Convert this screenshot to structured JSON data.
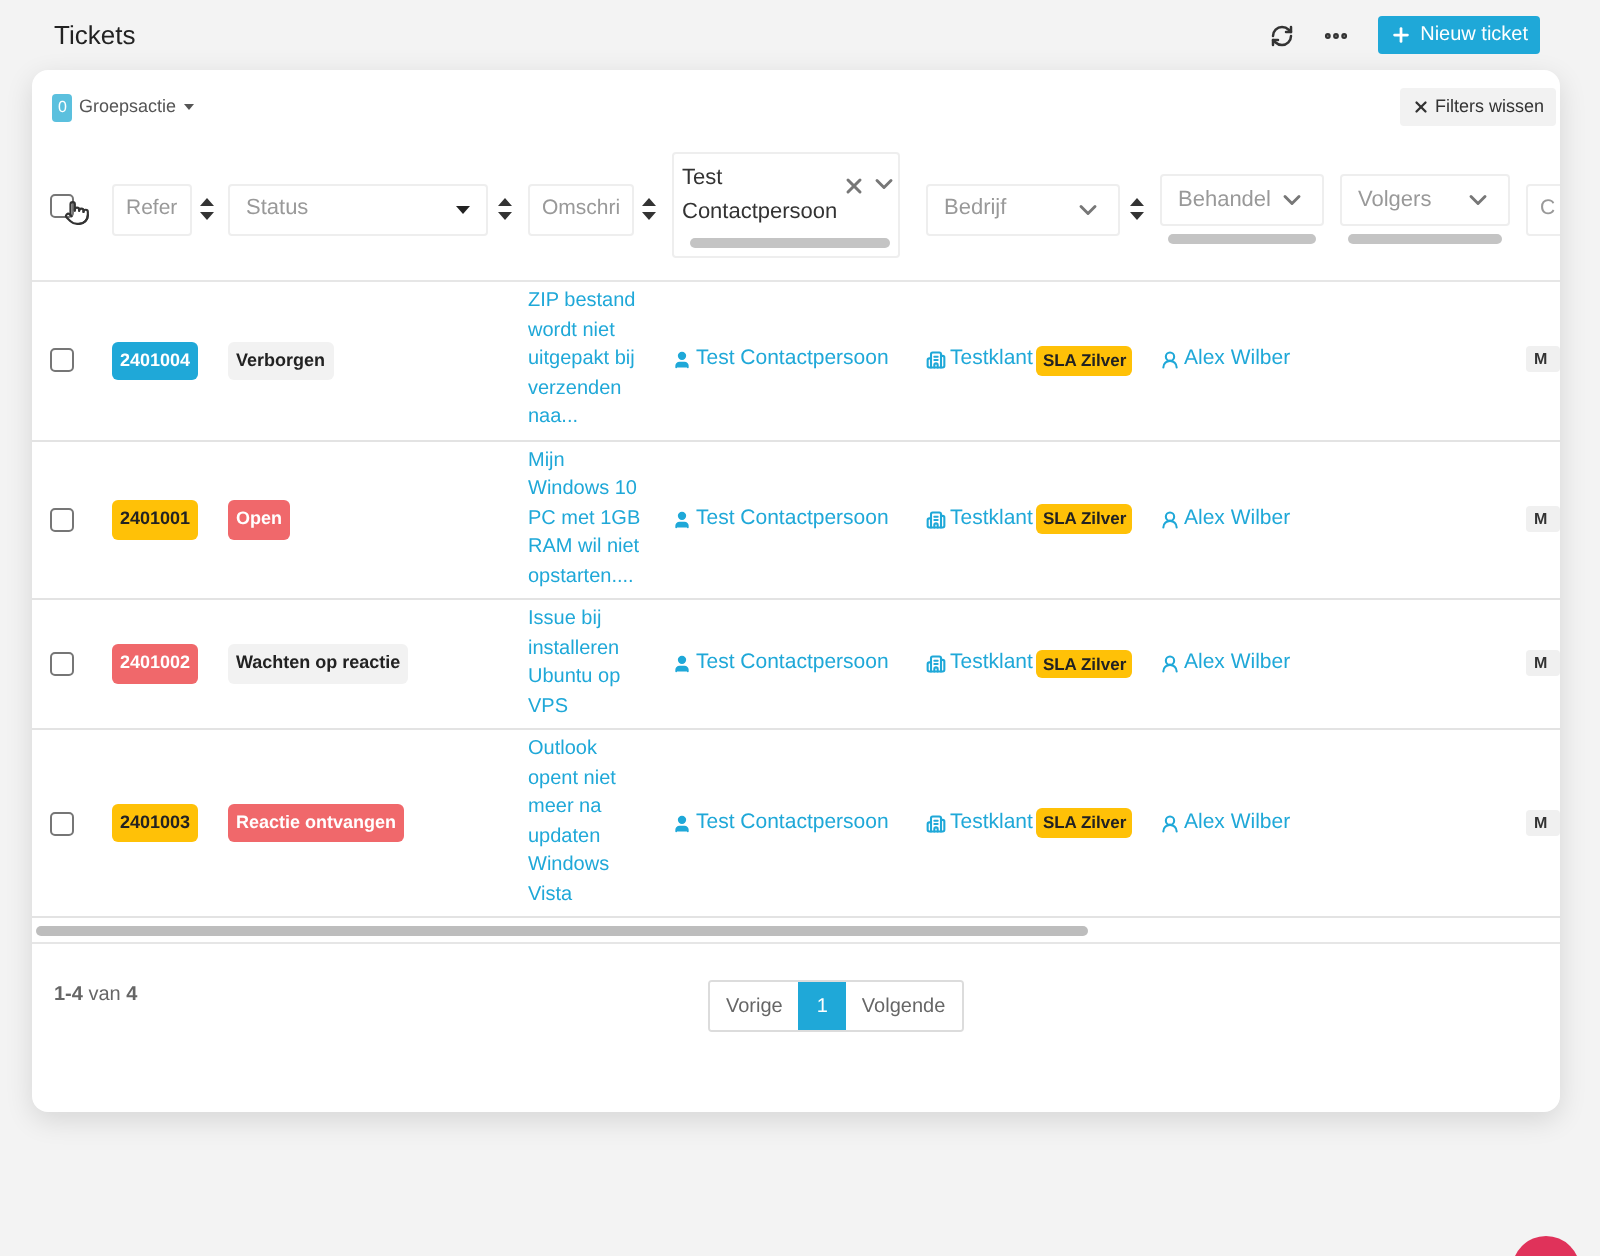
{
  "page": {
    "title": "Tickets",
    "new_button": "Nieuw ticket"
  },
  "toolbar": {
    "group_count": "0",
    "group_action": "Groepsactie",
    "clear_filters": "Filters wissen"
  },
  "filters": [
    {
      "kind": "checkbox",
      "checked": false
    },
    {
      "kind": "text",
      "placeholder": "Refer",
      "sortable": true
    },
    {
      "kind": "select",
      "placeholder": "Status",
      "sortable": true
    },
    {
      "kind": "text",
      "placeholder": "Omschri",
      "sortable": true
    },
    {
      "kind": "multiselect",
      "value": "Test Contactpersoon",
      "sortable": false
    },
    {
      "kind": "select",
      "placeholder": "Bedrijf",
      "sortable": true
    },
    {
      "kind": "select",
      "placeholder": "Behandel",
      "sortable": false
    },
    {
      "kind": "select",
      "placeholder": "Volgers",
      "sortable": false
    },
    {
      "kind": "text",
      "placeholder": "C",
      "sortable": false
    }
  ],
  "rows": [
    {
      "checked": false,
      "ref": {
        "text": "2401004",
        "color": "#1fa8d8"
      },
      "status": {
        "text": "Verborgen",
        "color": "#f2f2f2"
      },
      "description": "ZIP bestand wordt niet uitgepakt bij verzenden naa...",
      "contact": "Test Contactpersoon",
      "company": "Testklant",
      "sla": "SLA Zilver",
      "handler": "Alex Wilber",
      "column_9": "M"
    },
    {
      "checked": false,
      "ref": {
        "text": "2401001",
        "color": "#ffc107"
      },
      "status": {
        "text": "Open",
        "color": "#f0686b"
      },
      "description": "Mijn Windows 10 PC met 1GB RAM wil niet opstarten....",
      "contact": "Test Contactpersoon",
      "company": "Testklant",
      "sla": "SLA Zilver",
      "handler": "Alex Wilber",
      "column_9": "M"
    },
    {
      "checked": false,
      "ref": {
        "text": "2401002",
        "color": "#f0686b"
      },
      "status": {
        "text": "Wachten op reactie",
        "color": "#f2f2f2"
      },
      "description": "Issue bij installeren Ubuntu op VPS",
      "contact": "Test Contactpersoon",
      "company": "Testklant",
      "sla": "SLA Zilver",
      "handler": "Alex Wilber",
      "column_9": "M"
    },
    {
      "checked": false,
      "ref": {
        "text": "2401003",
        "color": "#ffc107"
      },
      "status": {
        "text": "Reactie ontvangen",
        "color": "#f0686b"
      },
      "description": "Outlook opent niet meer na updaten Windows Vista",
      "contact": "Test Contactpersoon",
      "company": "Testklant",
      "sla": "SLA Zilver",
      "handler": "Alex Wilber",
      "column_9": "M"
    }
  ],
  "footer": {
    "summary": "**1-4** van **4**"
  },
  "pagination": [
    {
      "label": "Vorige",
      "selected": false
    },
    {
      "label": "1",
      "selected": true
    },
    {
      "label": "Volgende",
      "selected": false
    }
  ]
}
